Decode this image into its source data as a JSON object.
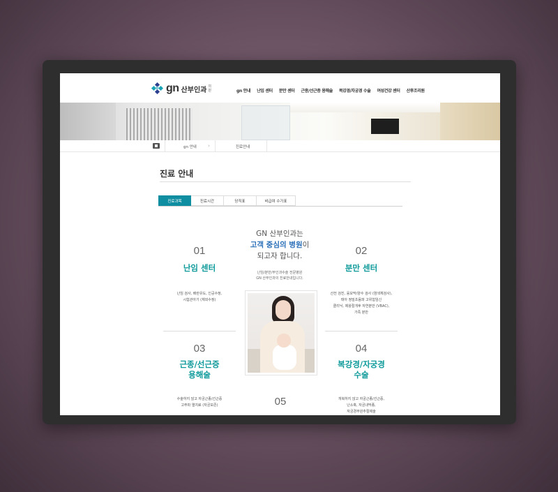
{
  "logo": {
    "gn": "gn",
    "name": "산부인과",
    "sub": "의원"
  },
  "nav": [
    "gn 안내",
    "난임 센터",
    "분만 센터",
    "근종/선근증 용해술",
    "복강경/자궁경 수술",
    "여성건강 센터",
    "산후조리원"
  ],
  "breadcrumb": [
    "gn 안내",
    "진료안내"
  ],
  "page_title": "진료 안내",
  "tabs": [
    "진료과목",
    "진료시간",
    "당직표",
    "비급여 수가표"
  ],
  "intro": {
    "line1": "GN 산부인과는",
    "highlight": "고객 중심의 병원",
    "suffix": "이",
    "line3": "되고자 합니다."
  },
  "intro_sub": [
    "난임/분만/부인과수술 전문병원",
    "GN 산부인과의 진료안내입니다."
  ],
  "centers": [
    {
      "num": "01",
      "name": "난임 센터",
      "desc": [
        "난임 검사, 배란유도, 인공수정,",
        "시험관아기 (체외수정)"
      ]
    },
    {
      "num": "02",
      "name": "분만 센터",
      "desc": [
        "산전 검진, 융모막/양수 검사 (염색체검사),",
        "태아 정밀초음파 고위험임신",
        "클리닉, 제왕절개후 자연분만 (VBAC),",
        "가족 분만"
      ]
    },
    {
      "num": "03",
      "name": "근종/선근증 용해술",
      "name_lines": [
        "근종/선근증",
        "용해술"
      ],
      "desc": [
        "수술하지 않고 자궁근종/선근증",
        "고주파 열치료 (자궁보존)"
      ]
    },
    {
      "num": "04",
      "name": "복강경/자궁경 수술",
      "name_lines": [
        "복강경/자궁경",
        "수술"
      ],
      "desc": [
        "개복하지 않고 자궁근종/선근증,",
        "난소혹, 자궁내막종,",
        "자궁경부원추절제술"
      ]
    },
    {
      "num": "05"
    }
  ],
  "colors": {
    "accent": "#0e8ea0",
    "highlight": "#2a6fb8",
    "frame": "#2e2e2e"
  }
}
